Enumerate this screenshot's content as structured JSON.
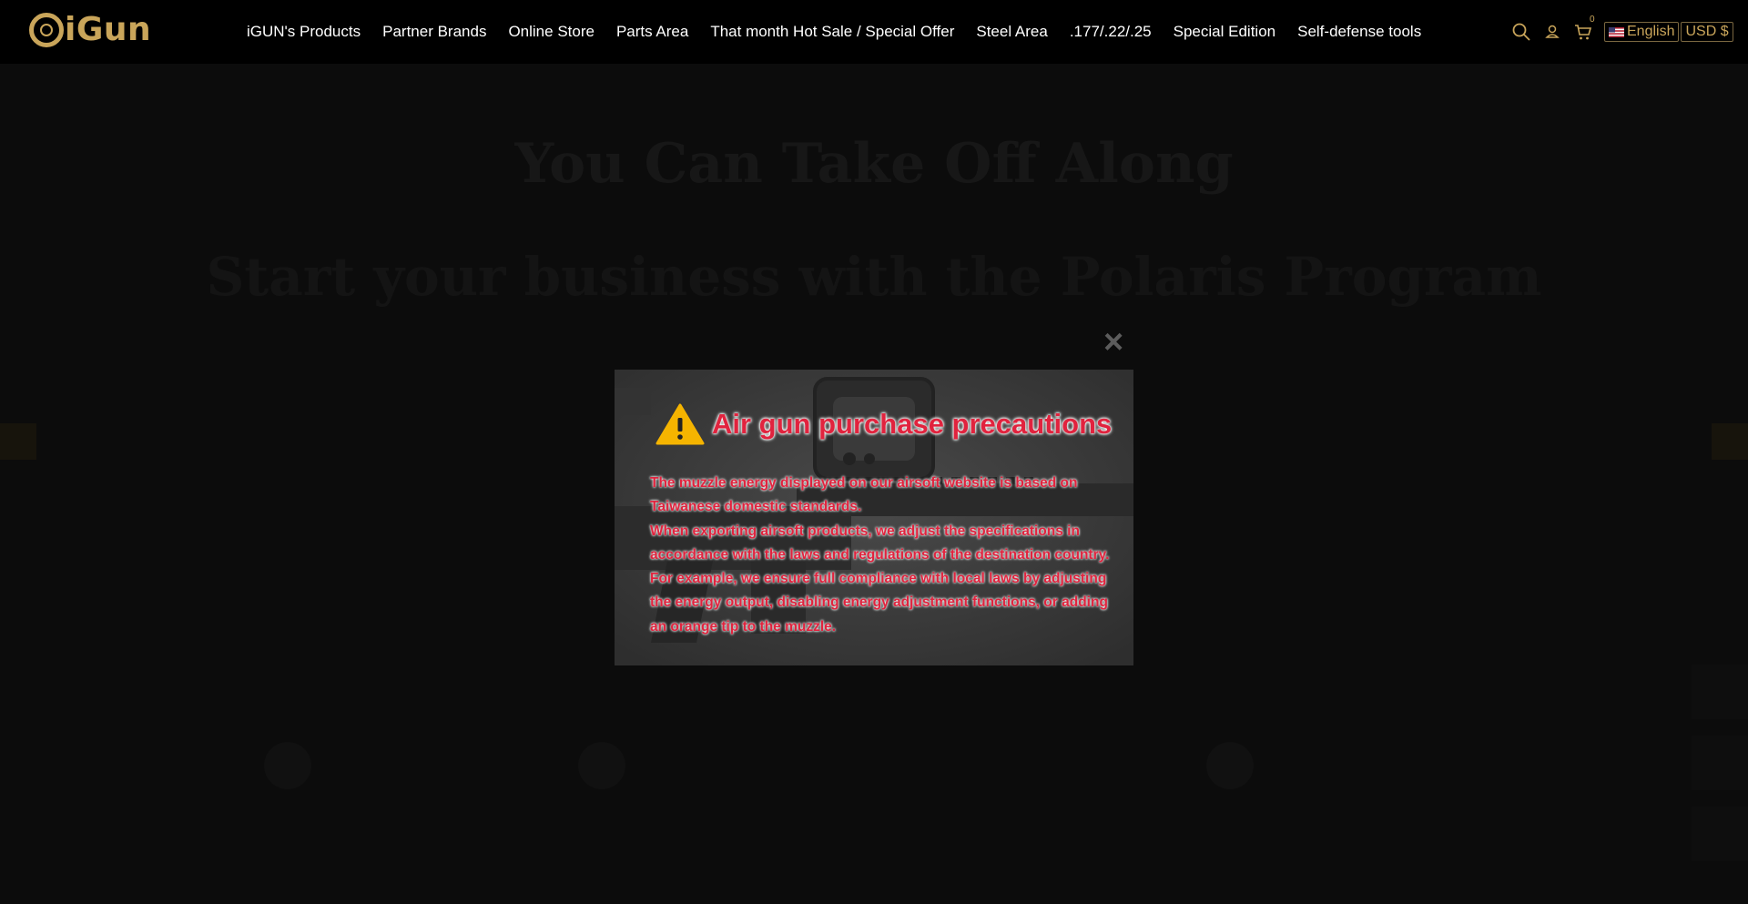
{
  "header": {
    "logo_text": "iGun",
    "nav": [
      "iGUN's Products",
      "Partner Brands",
      "Online Store",
      "Parts Area",
      "That month Hot Sale / Special Offer",
      "Steel Area",
      ".177/.22/.25",
      "Special Edition",
      "Self-defense tools"
    ],
    "tools": {
      "cart_count": "0",
      "language": "English",
      "currency": "USD $"
    },
    "accent_color": "#c9a55a"
  },
  "background": {
    "heading1": "You Can Take Off Along",
    "heading2": "Start your business with the Polaris Program"
  },
  "modal": {
    "close_label": "×",
    "title": "Air gun purchase precautions",
    "lines": [
      "The muzzle energy displayed on our airsoft website is based on",
      "Taiwanese domestic standards.",
      "When exporting airsoft products, we adjust the specifications in",
      "accordance with the laws and regulations of the destination country.",
      "For example, we ensure full compliance with local laws by adjusting",
      "the energy output, disabling energy adjustment functions, or adding",
      "an orange tip to the muzzle."
    ],
    "text_color": "#e1233e",
    "warning_color": "#f5b400"
  }
}
